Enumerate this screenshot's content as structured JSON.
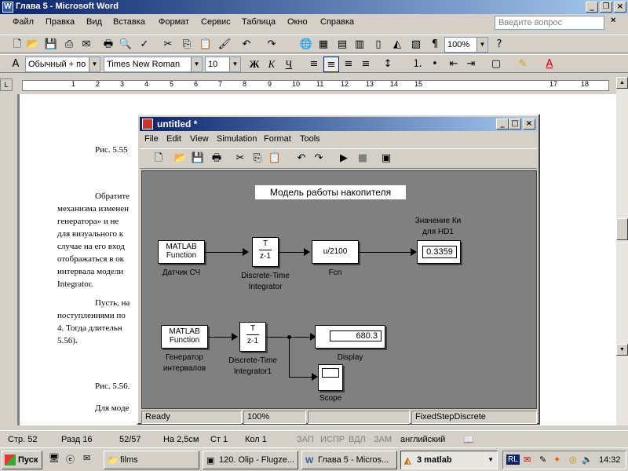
{
  "window": {
    "title": "Глава 5 - Microsoft Word"
  },
  "menu": {
    "items": [
      "Файл",
      "Правка",
      "Вид",
      "Вставка",
      "Формат",
      "Сервис",
      "Таблица",
      "Окно",
      "Справка"
    ],
    "help_placeholder": "Введите вопрос"
  },
  "format": {
    "style": "Обычный + по ц",
    "font": "Times New Roman",
    "size": "10",
    "zoom": "100%"
  },
  "ruler": {
    "marks": [
      "1",
      "2",
      "3",
      "4",
      "5",
      "6",
      "7",
      "8",
      "9",
      "10",
      "11",
      "12",
      "13",
      "14",
      "15",
      "17",
      "18"
    ]
  },
  "doc": {
    "lines": [
      "Рис. 5.55",
      "Обратите",
      "механизма изменен",
      "генератора» и не",
      "для визуального к",
      "случае на его вход",
      "отображаться в ок",
      "интервала модели",
      "Integrator.",
      "Пусть, на",
      "поступлениями по",
      "4. Тогда длительн",
      "5.56).",
      "Рис. 5.56.",
      "Для моде"
    ]
  },
  "simulink": {
    "title": "untitled *",
    "menu": [
      "File",
      "Edit",
      "View",
      "Simulation",
      "Format",
      "Tools"
    ],
    "model_title": "Модель работы накопителя",
    "blocks": {
      "matlab_fn1": {
        "l1": "MATLAB",
        "l2": "Function",
        "label": "Датчик СЧ"
      },
      "integrator1": {
        "num": "T",
        "den": "z-1",
        "label1": "Discrete-Time",
        "label2": "Integrator"
      },
      "fcn": {
        "expr": "u/2100",
        "label": "Fcn"
      },
      "display1": {
        "value": "0.3359",
        "label1": "Значение Ки",
        "label2": "для HD1"
      },
      "matlab_fn2": {
        "l1": "MATLAB",
        "l2": "Function",
        "label1": "Генератор",
        "label2": "интервалов"
      },
      "integrator2": {
        "num": "T",
        "den": "z-1",
        "label1": "Discrete-Time",
        "label2": "Integrator1"
      },
      "display2": {
        "value": "680.3",
        "label": "Display"
      },
      "scope": {
        "label": "Scope"
      }
    },
    "status": {
      "ready": "Ready",
      "zoom": "100%",
      "solver": "FixedStepDiscrete"
    }
  },
  "statusbar": {
    "page": "Стр. 52",
    "section": "Разд 16",
    "pages": "52/57",
    "at": "На 2,5см",
    "line": "Ст 1",
    "col": "Кол 1",
    "rec": "ЗАП",
    "trk": "ИСПР",
    "ext": "ВДЛ",
    "ovr": "ЗАМ",
    "lang": "английский"
  },
  "taskbar": {
    "start": "Пуск",
    "tasks": [
      "films",
      "120. Olip - Flugze...",
      "Глава 5 - Micros...",
      "3 matlab"
    ],
    "tray": [
      "RL"
    ],
    "clock": "14:32"
  }
}
